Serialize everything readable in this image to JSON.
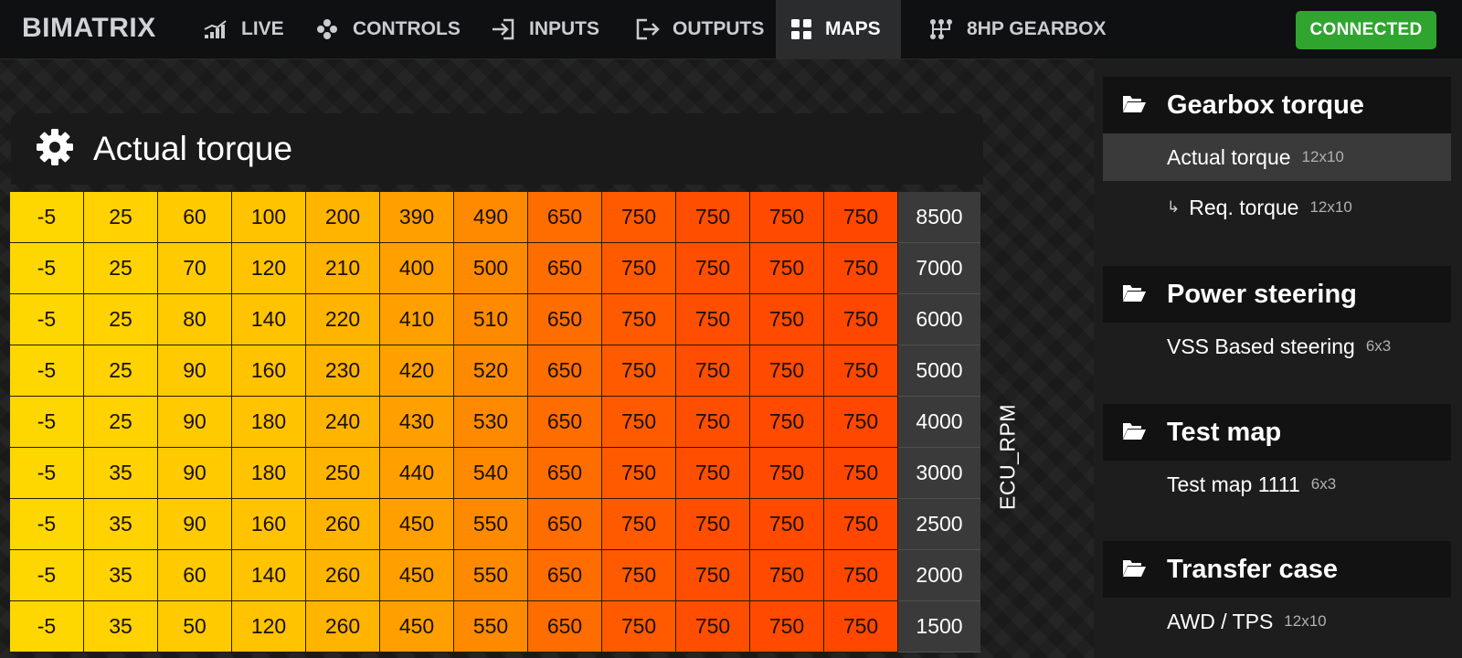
{
  "brand": "BIMATRIX",
  "nav": {
    "items": [
      {
        "label": "LIVE",
        "icon": "live-chart-icon"
      },
      {
        "label": "CONTROLS",
        "icon": "gamepad-icon"
      },
      {
        "label": "INPUTS",
        "icon": "sign-in-icon"
      },
      {
        "label": "OUTPUTS",
        "icon": "sign-out-icon"
      },
      {
        "label": "MAPS",
        "icon": "grid-icon",
        "active": true
      },
      {
        "label": "8HP GEARBOX",
        "icon": "gearbox-icon"
      }
    ],
    "status": "CONNECTED",
    "status_color": "#2fa52f"
  },
  "map": {
    "title": "Actual torque",
    "axis_label": "ECU_RPM",
    "rows": [
      {
        "rpm": "8500",
        "values": [
          "-5",
          "25",
          "60",
          "100",
          "200",
          "390",
          "490",
          "650",
          "750",
          "750",
          "750",
          "750"
        ]
      },
      {
        "rpm": "7000",
        "values": [
          "-5",
          "25",
          "70",
          "120",
          "210",
          "400",
          "500",
          "650",
          "750",
          "750",
          "750",
          "750"
        ]
      },
      {
        "rpm": "6000",
        "values": [
          "-5",
          "25",
          "80",
          "140",
          "220",
          "410",
          "510",
          "650",
          "750",
          "750",
          "750",
          "750"
        ]
      },
      {
        "rpm": "5000",
        "values": [
          "-5",
          "25",
          "90",
          "160",
          "230",
          "420",
          "520",
          "650",
          "750",
          "750",
          "750",
          "750"
        ]
      },
      {
        "rpm": "4000",
        "values": [
          "-5",
          "25",
          "90",
          "180",
          "240",
          "430",
          "530",
          "650",
          "750",
          "750",
          "750",
          "750"
        ]
      },
      {
        "rpm": "3000",
        "values": [
          "-5",
          "35",
          "90",
          "180",
          "250",
          "440",
          "540",
          "650",
          "750",
          "750",
          "750",
          "750"
        ]
      },
      {
        "rpm": "2500",
        "values": [
          "-5",
          "35",
          "90",
          "160",
          "260",
          "450",
          "550",
          "650",
          "750",
          "750",
          "750",
          "750"
        ]
      },
      {
        "rpm": "2000",
        "values": [
          "-5",
          "35",
          "60",
          "140",
          "260",
          "450",
          "550",
          "650",
          "750",
          "750",
          "750",
          "750"
        ]
      },
      {
        "rpm": "1500",
        "values": [
          "-5",
          "35",
          "50",
          "120",
          "260",
          "450",
          "550",
          "650",
          "750",
          "750",
          "750",
          "750"
        ]
      }
    ],
    "column_colors": [
      "#ffd700",
      "#ffd200",
      "#ffcb00",
      "#ffc300",
      "#ffb400",
      "#ffa000",
      "#ff8a00",
      "#ff6d00",
      "#ff5a00",
      "#ff4e00",
      "#ff4a00",
      "#ff4700"
    ]
  },
  "sidebar": {
    "groups": [
      {
        "title": "Gearbox torque",
        "items": [
          {
            "label": "Actual torque",
            "dims": "12x10",
            "selected": true,
            "sub": false
          },
          {
            "label": "Req. torque",
            "dims": "12x10",
            "selected": false,
            "sub": true,
            "prefix": "↳"
          }
        ]
      },
      {
        "title": "Power steering",
        "items": [
          {
            "label": "VSS Based steering",
            "dims": "6x3",
            "selected": false,
            "sub": false
          }
        ]
      },
      {
        "title": "Test map",
        "items": [
          {
            "label": "Test map 1111",
            "dims": "6x3",
            "selected": false,
            "sub": false
          }
        ]
      },
      {
        "title": "Transfer case",
        "items": [
          {
            "label": "AWD / TPS",
            "dims": "12x10",
            "selected": false,
            "sub": false
          }
        ]
      }
    ]
  }
}
